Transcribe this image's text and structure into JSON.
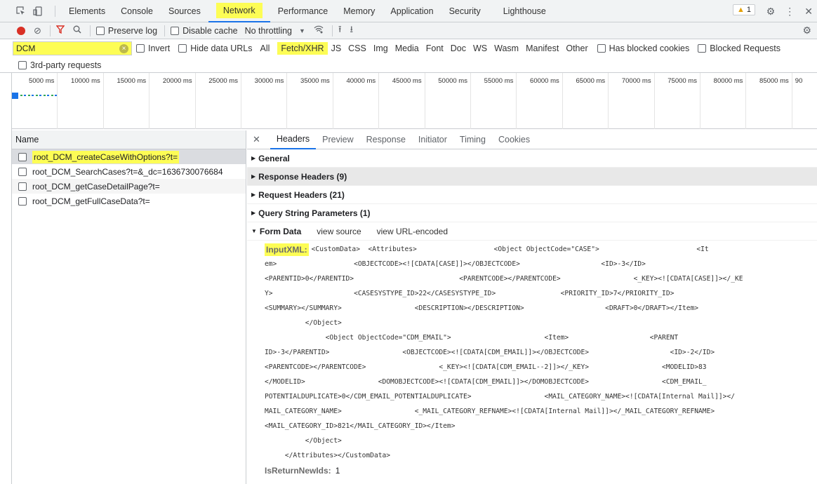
{
  "tabs": [
    "Elements",
    "Console",
    "Sources",
    "Network",
    "Performance",
    "Memory",
    "Application",
    "Security",
    "Lighthouse"
  ],
  "warning_count": "1",
  "toolbar": {
    "preserve_log": "Preserve log",
    "disable_cache": "Disable cache",
    "throttling": "No throttling"
  },
  "filter": {
    "value": "DCM",
    "invert": "Invert",
    "hide_data_urls": "Hide data URLs",
    "types": [
      "All",
      "Fetch/XHR",
      "JS",
      "CSS",
      "Img",
      "Media",
      "Font",
      "Doc",
      "WS",
      "Wasm",
      "Manifest",
      "Other"
    ],
    "has_blocked_cookies": "Has blocked cookies",
    "blocked_requests": "Blocked Requests",
    "third_party": "3rd-party requests"
  },
  "timeline_ticks": [
    "5000 ms",
    "10000 ms",
    "15000 ms",
    "20000 ms",
    "25000 ms",
    "30000 ms",
    "35000 ms",
    "40000 ms",
    "45000 ms",
    "50000 ms",
    "55000 ms",
    "60000 ms",
    "65000 ms",
    "70000 ms",
    "75000 ms",
    "80000 ms",
    "85000 ms",
    "90"
  ],
  "list": {
    "header": "Name",
    "requests": [
      "root_DCM_createCaseWithOptions?t=",
      "root_DCM_SearchCases?t=&_dc=1636730076684",
      "root_DCM_getCaseDetailPage?t=",
      "root_DCM_getFullCaseData?t="
    ]
  },
  "details": {
    "tabs": [
      "Headers",
      "Preview",
      "Response",
      "Initiator",
      "Timing",
      "Cookies"
    ],
    "sections": {
      "general": "General",
      "response_headers": "Response Headers (9)",
      "request_headers": "Request Headers (21)",
      "query_params": "Query String Parameters (1)",
      "form_data": "Form Data"
    },
    "view_source": "view source",
    "view_url_encoded": "view URL-encoded",
    "input_xml_key": "InputXML:",
    "xml_lines": [
      "<CustomData>  <Attributes>                   <Object ObjectCode=\"CASE\">                        <It",
      "em>                   <OBJECTCODE><![CDATA[CASE]]></OBJECTCODE>                    <ID>-3</ID>",
      "<PARENTID>0</PARENTID>                          <PARENTCODE></PARENTCODE>                  <_KEY><![CDATA[CASE]]></_KE",
      "Y>                    <CASESYSTYPE_ID>22</CASESYSTYPE_ID>                <PRIORITY_ID>7</PRIORITY_ID>",
      "<SUMMARY></SUMMARY>                  <DESCRIPTION></DESCRIPTION>                    <DRAFT>0</DRAFT></Item>",
      "          </Object>",
      "               <Object ObjectCode=\"CDM_EMAIL\">                       <Item>                    <PARENT",
      "ID>-3</PARENTID>                  <OBJECTCODE><![CDATA[CDM_EMAIL]]></OBJECTCODE>                    <ID>-2</ID>",
      "<PARENTCODE></PARENTCODE>                  <_KEY><![CDATA[CDM_EMAIL--2]]></_KEY>                  <MODELID>83",
      "</MODELID>                  <DOMOBJECTCODE><![CDATA[CDM_EMAIL]]></DOMOBJECTCODE>                  <CDM_EMAIL_",
      "POTENTIALDUPLICATE>0</CDM_EMAIL_POTENTIALDUPLICATE>                  <MAIL_CATEGORY_NAME><![CDATA[Internal Mail]]></",
      "MAIL_CATEGORY_NAME>                  <_MAIL_CATEGORY_REFNAME><![CDATA[Internal Mail]]></_MAIL_CATEGORY_REFNAME>",
      "<MAIL_CATEGORY_ID>821</MAIL_CATEGORY_ID></Item>",
      "          </Object>",
      "     </Attributes></CustomData>"
    ],
    "return_key": "IsReturnNewIds:",
    "return_value": "1"
  },
  "colors": {
    "highlight": "#fdfd55",
    "accent": "#1a73e8",
    "record": "#d93025"
  }
}
